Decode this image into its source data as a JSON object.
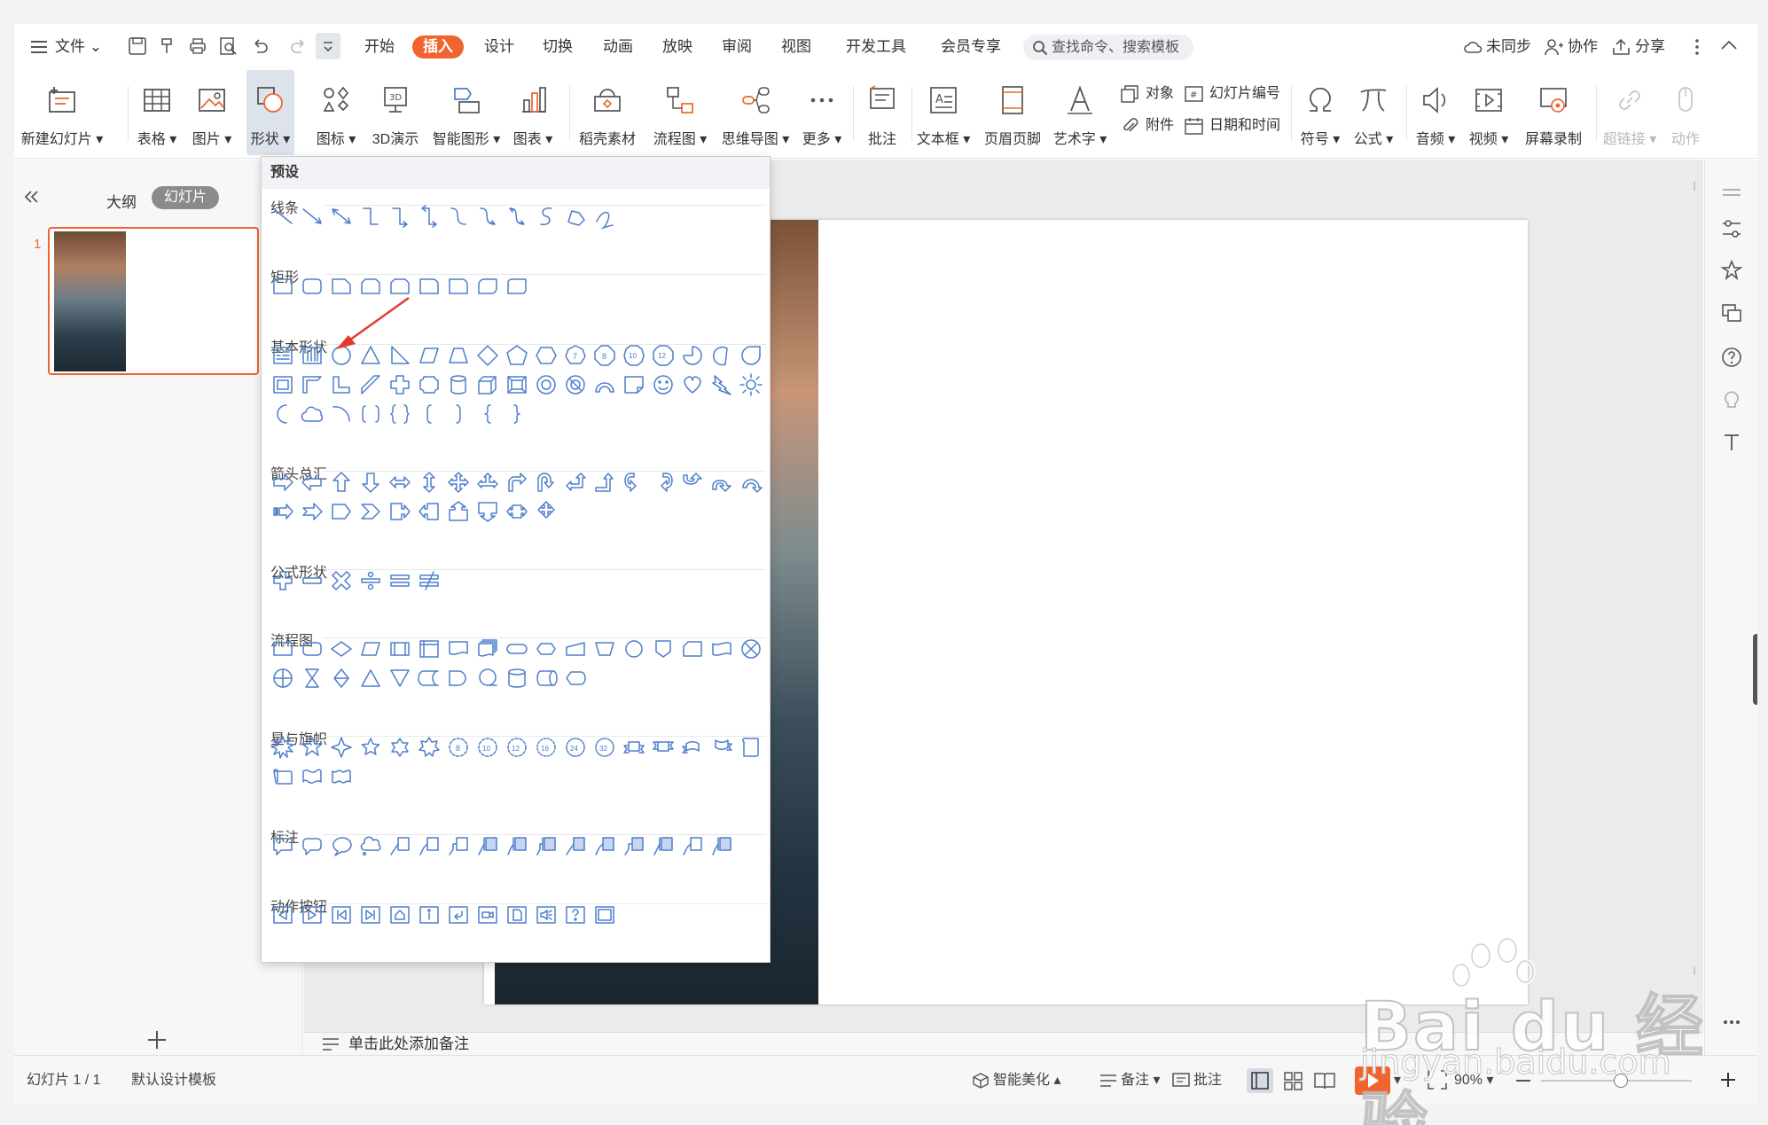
{
  "menu": {
    "file": "文件",
    "tabs": [
      "开始",
      "插入",
      "设计",
      "切换",
      "动画",
      "放映",
      "审阅",
      "视图",
      "开发工具",
      "会员专享"
    ],
    "active_tab": "插入",
    "search_placeholder": "查找命令、搜索模板",
    "sync": "未同步",
    "collab": "协作",
    "share": "分享"
  },
  "ribbon": {
    "new_slide": "新建幻灯片",
    "table": "表格",
    "picture": "图片",
    "shape": "形状",
    "icon": "图标",
    "threed": "3D演示",
    "smartart": "智能图形",
    "chart": "图表",
    "material": "稻壳素材",
    "flowchart": "流程图",
    "mindmap": "思维导图",
    "more": "更多",
    "comment": "批注",
    "textbox": "文本框",
    "header_footer": "页眉页脚",
    "wordart": "艺术字",
    "object": "对象",
    "slide_number": "幻灯片编号",
    "attachment": "附件",
    "date_time": "日期和时间",
    "symbol": "符号",
    "formula": "公式",
    "audio": "音频",
    "video": "视频",
    "screen_record": "屏幕录制",
    "hyperlink": "超链接",
    "action": "动作"
  },
  "left_panel": {
    "outline_tab": "大纲",
    "slides_tab": "幻灯片",
    "slide_index": "1"
  },
  "shapes_menu": {
    "header": "预设",
    "sections": {
      "lines": "线条",
      "rect": "矩形",
      "basic": "基本形状",
      "arrows": "箭头总汇",
      "equation": "公式形状",
      "flow": "流程图",
      "stars": "星与旗帜",
      "callouts": "标注",
      "actions": "动作按钮"
    }
  },
  "notes_placeholder": "单击此处添加备注",
  "status": {
    "slide_count": "幻灯片 1 / 1",
    "template": "默认设计模板",
    "beautify": "智能美化",
    "notes": "备注",
    "comments": "批注",
    "zoom": "90%"
  },
  "watermark": {
    "brand": "Bai du 经验",
    "url": "jingyan.baidu.com"
  },
  "colors": {
    "accent": "#f0652f",
    "shape_stroke": "#4f7ecb",
    "annotation_arrow": "#e23b2e"
  }
}
